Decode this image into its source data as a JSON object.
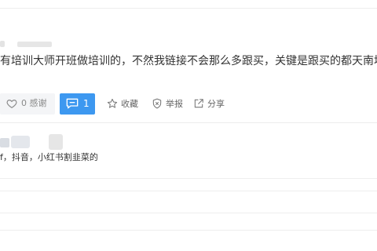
{
  "post": {
    "content": "有培训大师开班做培训的，不然我链接不会那么多跟买，关键是跟买的都天南地北，"
  },
  "actions": {
    "thanks_label": "0 感谢",
    "comment_count": "1",
    "favorite_label": "收藏",
    "report_label": "举报",
    "share_label": "分享"
  },
  "reply": {
    "text": "f，抖音，小红书割韭菜的"
  },
  "colors": {
    "accent": "#3d98f0",
    "thanks_bg": "#f4f5f7",
    "text": "#333333"
  }
}
